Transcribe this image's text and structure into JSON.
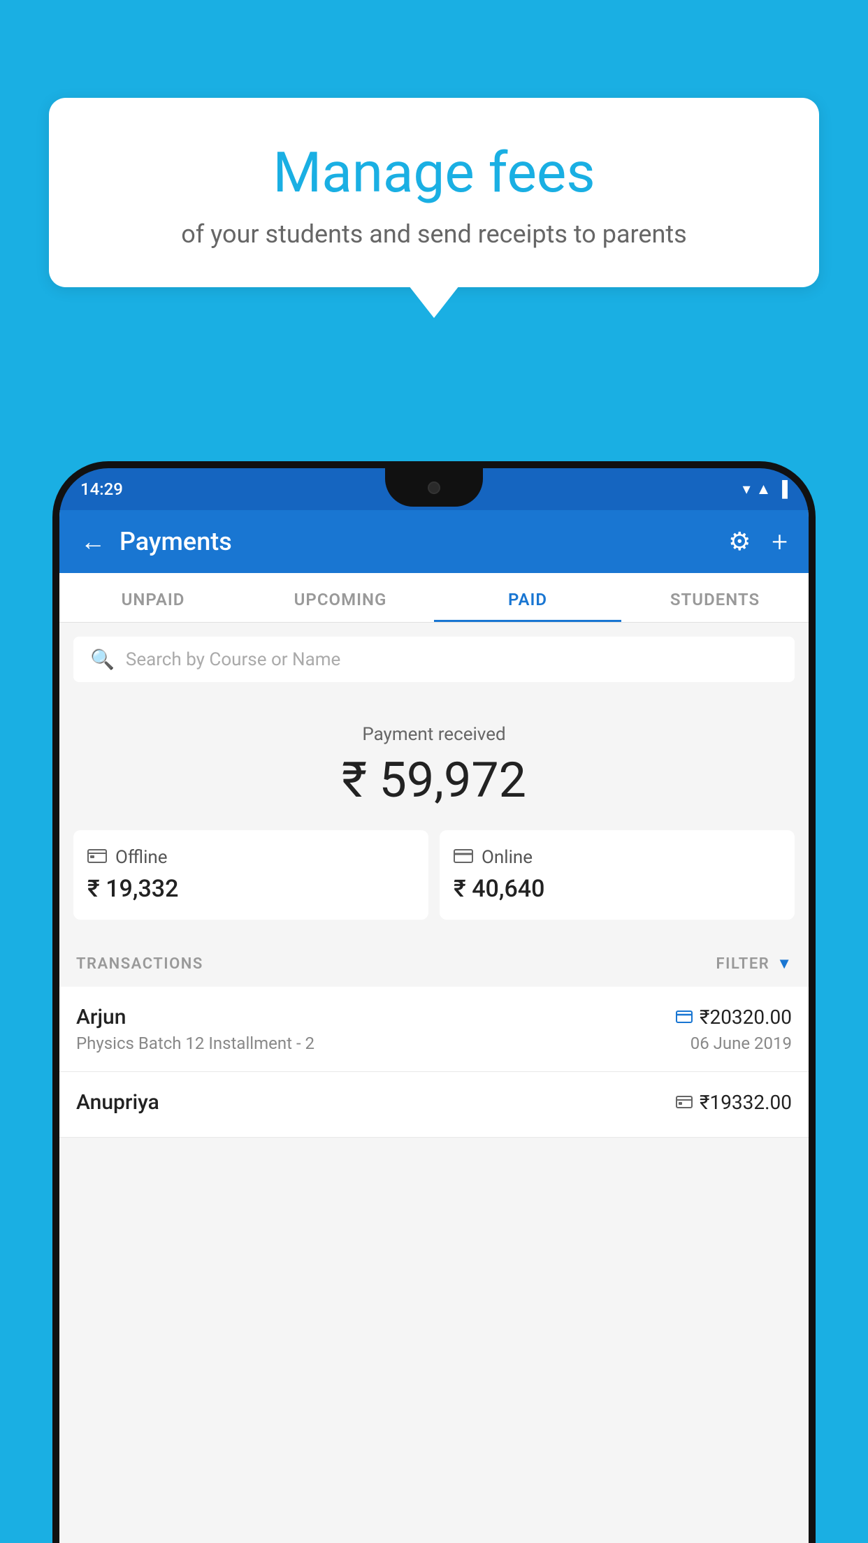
{
  "background_color": "#1AAFE3",
  "speech_bubble": {
    "title": "Manage fees",
    "subtitle": "of your students and send receipts to parents"
  },
  "phone": {
    "status_bar": {
      "time": "14:29",
      "icons": "▲ ▲ ▐"
    },
    "app_bar": {
      "title": "Payments",
      "back_label": "←",
      "gear_label": "⚙",
      "plus_label": "+"
    },
    "tabs": [
      {
        "label": "UNPAID",
        "active": false
      },
      {
        "label": "UPCOMING",
        "active": false
      },
      {
        "label": "PAID",
        "active": true
      },
      {
        "label": "STUDENTS",
        "active": false
      }
    ],
    "search": {
      "placeholder": "Search by Course or Name"
    },
    "payment_received": {
      "label": "Payment received",
      "amount": "₹ 59,972",
      "offline": {
        "method": "Offline",
        "amount": "₹ 19,332"
      },
      "online": {
        "method": "Online",
        "amount": "₹ 40,640"
      }
    },
    "transactions": {
      "header_label": "TRANSACTIONS",
      "filter_label": "FILTER",
      "rows": [
        {
          "name": "Arjun",
          "course": "Physics Batch 12 Installment - 2",
          "amount": "₹20320.00",
          "date": "06 June 2019",
          "method_icon": "card"
        },
        {
          "name": "Anupriya",
          "amount": "₹19332.00",
          "method_icon": "cash"
        }
      ]
    }
  }
}
